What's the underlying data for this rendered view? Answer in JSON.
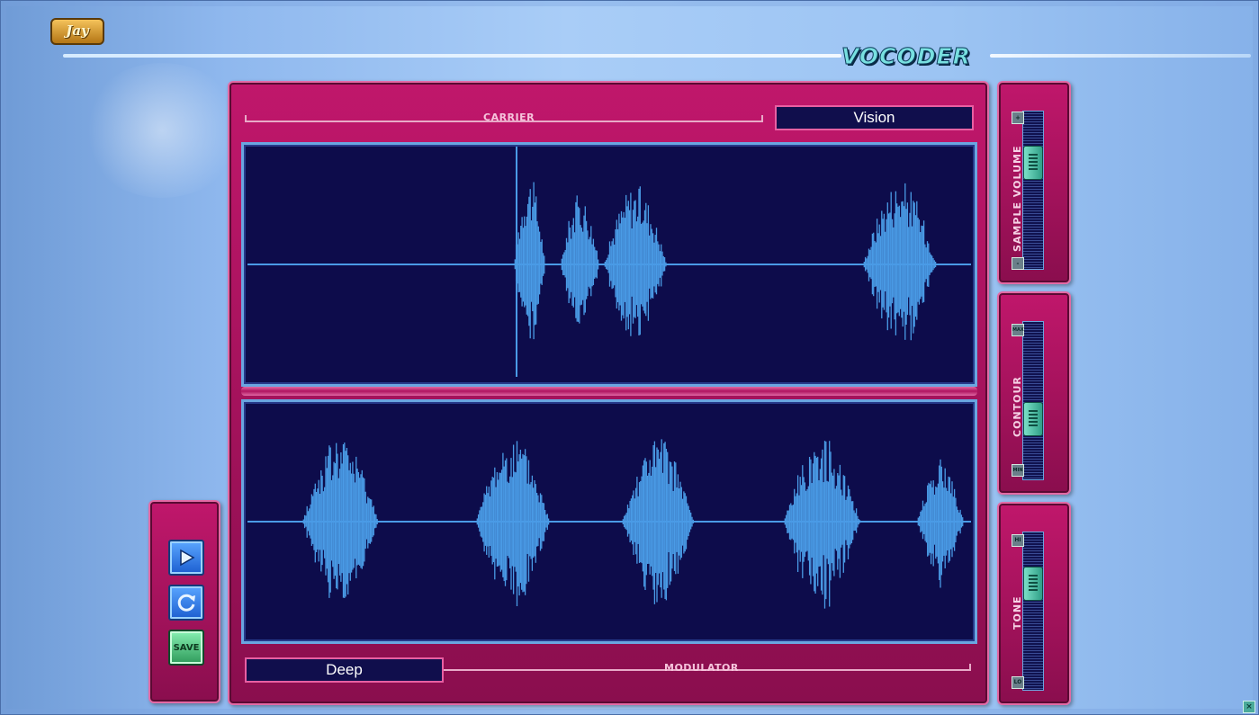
{
  "app": {
    "logo_text": "Jay",
    "title": "VOCODER"
  },
  "carrier": {
    "label": "CARRIER",
    "name": "Vision"
  },
  "modulator": {
    "label": "MODULATOR",
    "name": "Deep"
  },
  "sliders": {
    "sample_volume": {
      "label": "SAMPLE VOLUME",
      "top_icon": "+",
      "bottom_icon": "-",
      "level": 0.72
    },
    "contour": {
      "label": "CONTOUR",
      "top_icon": "MAX",
      "bottom_icon": "MIN",
      "level": 0.35
    },
    "tone": {
      "label": "TONE",
      "top_icon": "HI",
      "bottom_icon": "LO",
      "level": 0.72
    }
  },
  "buttons": {
    "play_icon": "play-icon",
    "loop_icon": "loop-icon",
    "save_label": "SAVE"
  },
  "colors": {
    "panel": "#a8125e",
    "waveform_bg": "#0d0c4b",
    "waveform": "#4a9be6",
    "thumb": "#4fc0a8"
  }
}
